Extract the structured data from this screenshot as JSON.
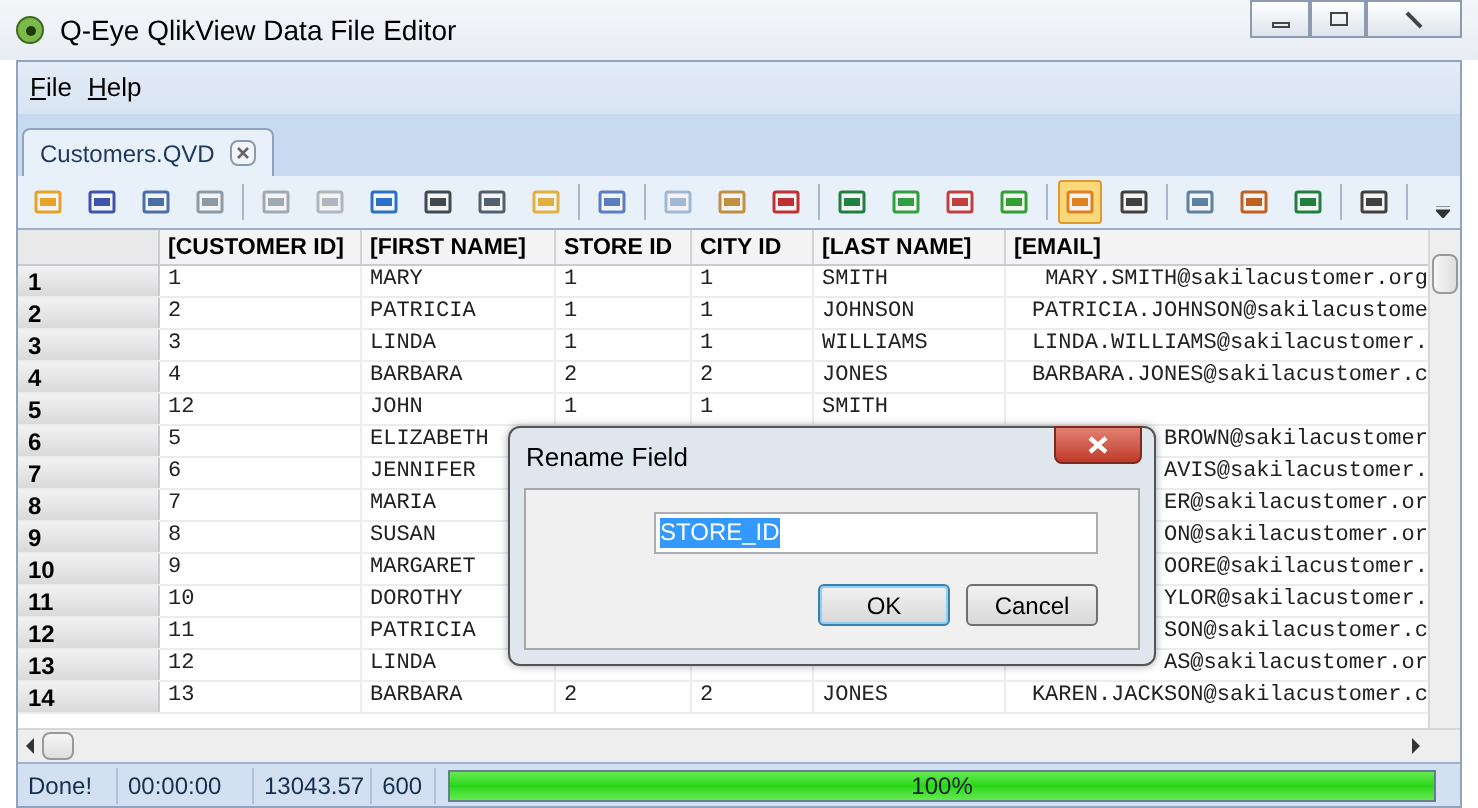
{
  "window": {
    "title": "Q-Eye QlikView Data File Editor"
  },
  "menu": [
    "File",
    "Help"
  ],
  "tabs": [
    {
      "label": "Customers.QVD",
      "selected": true
    }
  ],
  "toolbar": [
    {
      "selected": false
    },
    {
      "selected": false
    },
    {
      "selected": false
    },
    {
      "selected": false
    },
    {
      "selected": false
    },
    {
      "selected": false
    },
    {
      "selected": false
    },
    {
      "selected": false
    },
    {
      "selected": false
    },
    {
      "selected": false
    },
    {
      "selected": false
    },
    {
      "selected": false
    },
    {
      "selected": false
    },
    {
      "selected": false
    },
    {
      "selected": false
    },
    {
      "selected": false
    },
    {
      "selected": false
    },
    {
      "selected": false
    },
    {
      "selected": true
    },
    {
      "selected": false
    },
    {
      "selected": false
    },
    {
      "selected": false
    },
    {
      "selected": false
    },
    {
      "selected": false
    }
  ],
  "table": {
    "columns": [
      "[CUSTOMER ID]",
      "[FIRST NAME]",
      "STORE ID",
      "CITY ID",
      "[LAST NAME]",
      "[EMAIL]"
    ],
    "rows": [
      {
        "header": "1",
        "cells": [
          "1",
          "MARY",
          "1",
          "1",
          "SMITH",
          "MARY.SMITH@sakilacustomer.org"
        ]
      },
      {
        "header": "2",
        "cells": [
          "2",
          "PATRICIA",
          "1",
          "1",
          "JOHNSON",
          "PATRICIA.JOHNSON@sakilacustome"
        ]
      },
      {
        "header": "3",
        "cells": [
          "3",
          "LINDA",
          "1",
          "1",
          "WILLIAMS",
          "LINDA.WILLIAMS@sakilacustomer."
        ]
      },
      {
        "header": "4",
        "cells": [
          "4",
          "BARBARA",
          "2",
          "2",
          "JONES",
          "BARBARA.JONES@sakilacustomer.c"
        ]
      },
      {
        "header": "5",
        "cells": [
          "12",
          "JOHN",
          "1",
          "1",
          "SMITH",
          ""
        ]
      },
      {
        "header": "6",
        "cells": [
          "5",
          "ELIZABETH",
          "",
          "",
          "",
          "BROWN@sakilacustomer"
        ]
      },
      {
        "header": "7",
        "cells": [
          "6",
          "JENNIFER",
          "",
          "",
          "",
          "AVIS@sakilacustomer."
        ]
      },
      {
        "header": "8",
        "cells": [
          "7",
          "MARIA",
          "",
          "",
          "",
          "ER@sakilacustomer.or"
        ]
      },
      {
        "header": "9",
        "cells": [
          "8",
          "SUSAN",
          "",
          "",
          "",
          "ON@sakilacustomer.or"
        ]
      },
      {
        "header": "10",
        "cells": [
          "9",
          "MARGARET",
          "",
          "",
          "",
          "OORE@sakilacustomer."
        ]
      },
      {
        "header": "11",
        "cells": [
          "10",
          "DOROTHY",
          "",
          "",
          "",
          "YLOR@sakilacustomer."
        ]
      },
      {
        "header": "12",
        "cells": [
          "11",
          "PATRICIA",
          "",
          "",
          "",
          "SON@sakilacustomer.c"
        ]
      },
      {
        "header": "13",
        "cells": [
          "12",
          "LINDA",
          "",
          "",
          "",
          "AS@sakilacustomer.or"
        ]
      },
      {
        "header": "14",
        "cells": [
          "13",
          "BARBARA",
          "2",
          "2",
          "JONES",
          "KAREN.JACKSON@sakilacustomer.c"
        ]
      }
    ]
  },
  "dialog": {
    "title": "Rename Field",
    "value": "STORE_ID",
    "buttons": [
      {
        "label": "OK",
        "default": true
      },
      {
        "label": "Cancel",
        "default": false
      }
    ]
  },
  "status_bar": {
    "texts": [
      "Done!",
      "00:00:00",
      "13043.57",
      "600"
    ],
    "progress": {
      "level": 1.0,
      "label": "100%"
    }
  }
}
